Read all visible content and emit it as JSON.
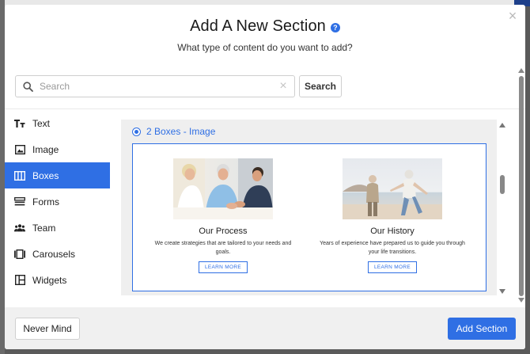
{
  "modal": {
    "title": "Add A New Section",
    "subtitle": "What type of content do you want to add?",
    "close_icon": "close-icon",
    "help_icon": "help-icon",
    "accent_color": "#2f6fe4"
  },
  "search": {
    "placeholder": "Search",
    "value": "",
    "button_label": "Search"
  },
  "sidebar": {
    "items": [
      {
        "label": "Text",
        "icon": "text-icon",
        "active": false
      },
      {
        "label": "Image",
        "icon": "image-icon",
        "active": false
      },
      {
        "label": "Boxes",
        "icon": "boxes-icon",
        "active": true
      },
      {
        "label": "Forms",
        "icon": "forms-icon",
        "active": false
      },
      {
        "label": "Team",
        "icon": "team-icon",
        "active": false
      },
      {
        "label": "Carousels",
        "icon": "carousel-icon",
        "active": false
      },
      {
        "label": "Widgets",
        "icon": "widgets-icon",
        "active": false
      }
    ]
  },
  "content": {
    "option_label": "2 Boxes - Image",
    "boxes": [
      {
        "title": "Our Process",
        "description": "We create strategies that are tailored to your needs and goals.",
        "button_label": "LEARN MORE",
        "image": "advisor-meeting-photo"
      },
      {
        "title": "Our History",
        "description": "Years of experience have prepared us to guide you through your life transitions.",
        "button_label": "LEARN MORE",
        "image": "beach-couple-photo"
      }
    ]
  },
  "footer": {
    "cancel_label": "Never Mind",
    "submit_label": "Add Section"
  }
}
